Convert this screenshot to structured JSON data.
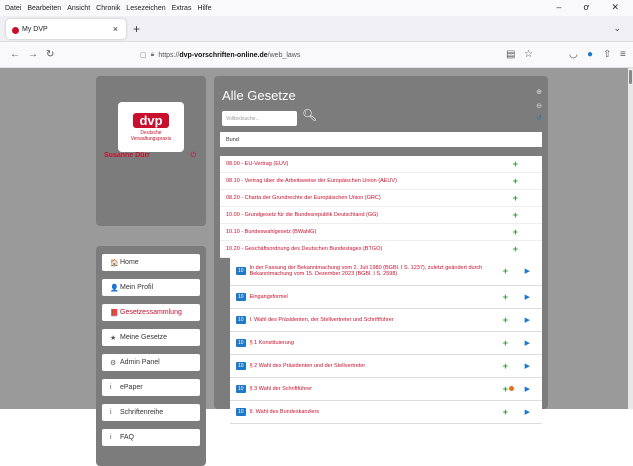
{
  "menubar": {
    "items": [
      "Datei",
      "Bearbeiten",
      "Ansicht",
      "Chronik",
      "Lesezeichen",
      "Extras",
      "Hilfe"
    ]
  },
  "window": {
    "min": "–",
    "max": "ơ",
    "close": "✕"
  },
  "tab": {
    "title": "My DVP",
    "close": "×",
    "new": "+"
  },
  "url": {
    "prefix": "https://",
    "host": "dvp-vorschriften-online.de",
    "path": "/web_laws"
  },
  "logo": {
    "mark": "dvp",
    "subtitle_line1": "Deutsche",
    "subtitle_line2": "Verwaltungspraxis"
  },
  "user": {
    "name": "Susanne Dürr"
  },
  "menu": [
    {
      "label": "Home",
      "icon": "home-icon",
      "glyph": "🏠"
    },
    {
      "label": "Mein Profil",
      "icon": "user-icon",
      "glyph": "👤"
    },
    {
      "label": "Gesetzessammlung",
      "icon": "book-icon",
      "glyph": "📕"
    },
    {
      "label": "Meine Gesetze",
      "icon": "star-icon",
      "glyph": "★"
    },
    {
      "label": "Admin Panel",
      "icon": "gear-icon",
      "glyph": "⚙"
    },
    {
      "label": "ePaper",
      "icon": "info-icon",
      "glyph": "i"
    },
    {
      "label": "Schriftenreihe",
      "icon": "info-icon",
      "glyph": "i"
    },
    {
      "label": "FAQ",
      "icon": "info-icon",
      "glyph": "i"
    }
  ],
  "main": {
    "title": "Alle Gesetze",
    "search_placeholder": "Volltextsuche...",
    "category": "Bund",
    "laws": [
      "08.00 - EU-Vertrag (EUV)",
      "08.10 - Vertrag über die Arbeitsweise der Europäischen Union (AEUV)",
      "08.20 - Charta der Grundrechte der Europäischen Union (GRC)",
      "10.00 - Grundgesetz für die Bundesrepublik Deutschland (GG)",
      "10.10 - Bundeswahlgesetz (BWahlG)",
      "10.20 - Geschäftsordnung des Deutschen Bundestages (BTGO)"
    ],
    "sections": [
      {
        "badge": "10",
        "text": "In der Fassung der Bekanntmachung vom 2. Juli 1980 (BGBl. I S. 1237), zuletzt geändert durch Bekanntmachung vom 15. Dezember 2023 (BGBl. I S. 2598)"
      },
      {
        "badge": "10",
        "text": "Eingangsformel"
      },
      {
        "badge": "10",
        "text": "I. Wahl des Präsidenten, der Stellvertreter und Schriftführer"
      },
      {
        "badge": "10",
        "text": "§ 1 Konstituierung"
      },
      {
        "badge": "10",
        "text": "§ 2 Wahl des Präsidenten und der Stellvertreter"
      },
      {
        "badge": "10",
        "text": "§ 3 Wahl der Schriftführer"
      },
      {
        "badge": "10",
        "text": "II. Wahl des Bundeskanzlers"
      }
    ]
  }
}
